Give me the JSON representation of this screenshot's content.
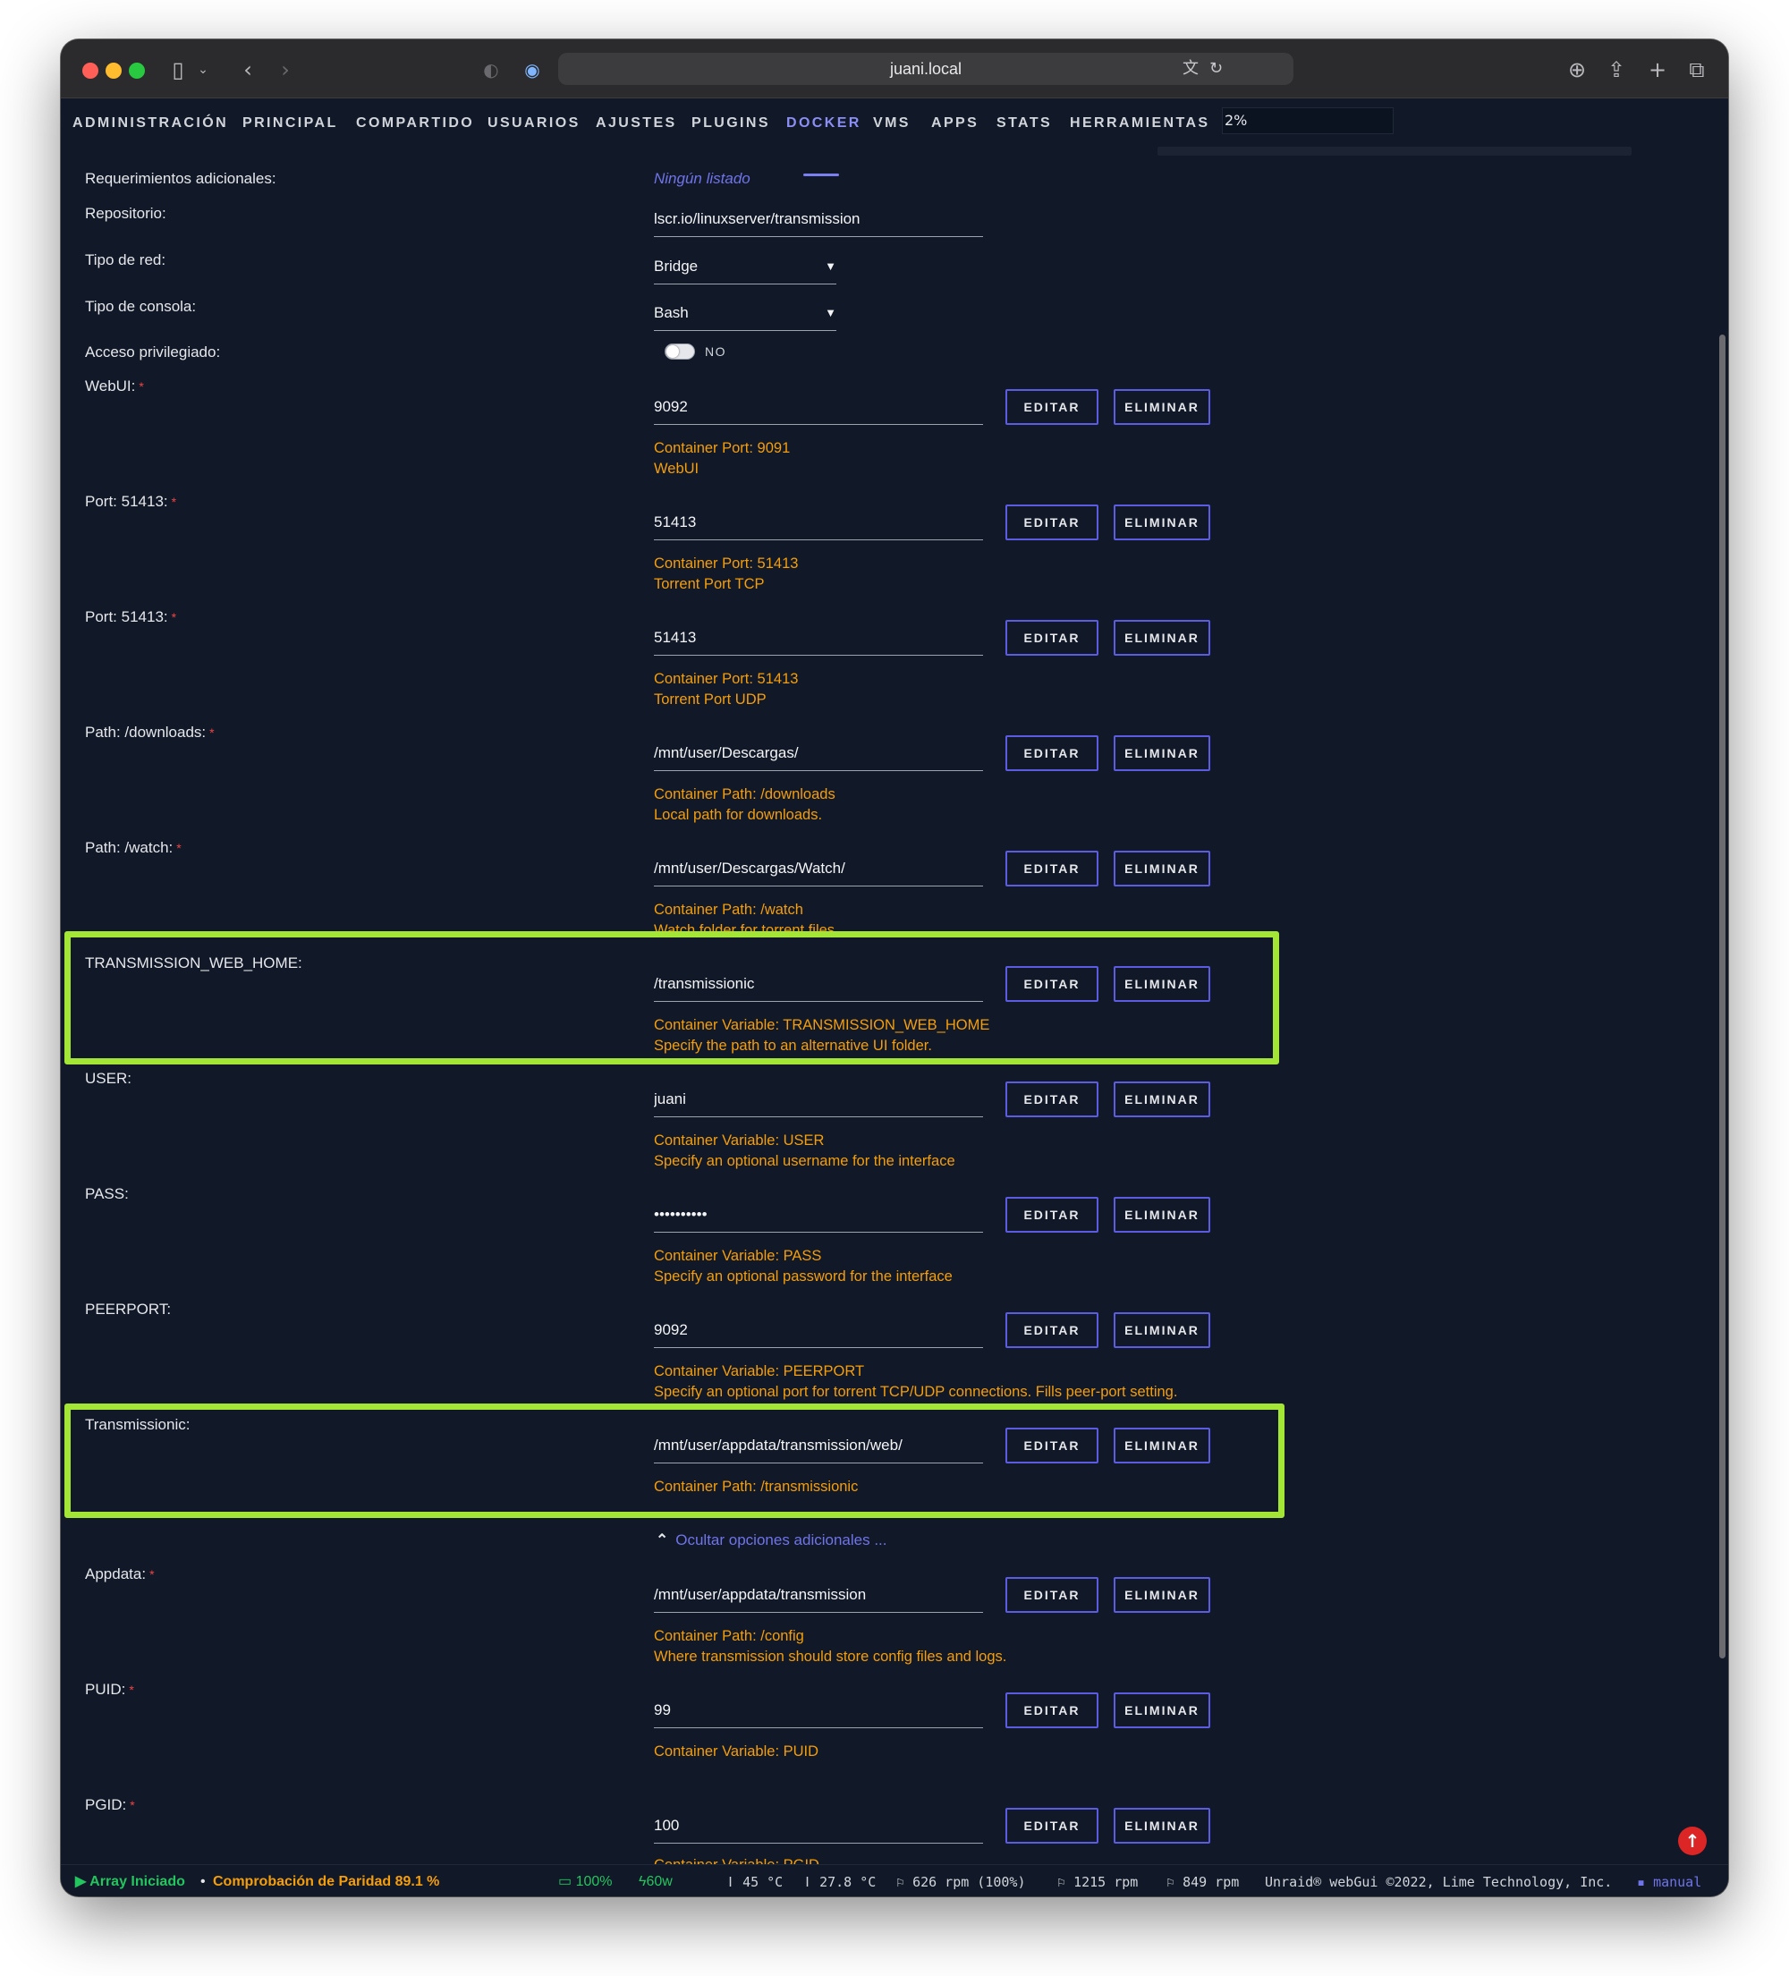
{
  "browser": {
    "url": "juani.local"
  },
  "nav": {
    "items": [
      "ADMINISTRACIÓN",
      "PRINCIPAL",
      "COMPARTIDO",
      "USUARIOS",
      "AJUSTES",
      "PLUGINS",
      "DOCKER",
      "VMS",
      "APPS",
      "STATS",
      "HERRAMIENTAS"
    ],
    "active": "DOCKER",
    "cpu_load": "2%"
  },
  "settings": {
    "extra_requirements_label": "Requerimientos adicionales:",
    "extra_requirements_value": "Ningún listado",
    "repository_label": "Repositorio:",
    "repository_value": "lscr.io/linuxserver/transmission",
    "network_label": "Tipo de red:",
    "network_value": "Bridge",
    "console_label": "Tipo de consola:",
    "console_value": "Bash",
    "privileged_label": "Acceso privilegiado:",
    "privileged_value": "NO"
  },
  "buttons": {
    "edit": "EDITAR",
    "delete": "ELIMINAR"
  },
  "fields": [
    {
      "label": "WebUI:",
      "required": true,
      "value": "9092",
      "desc1": "Container Port: 9091",
      "desc2": "WebUI"
    },
    {
      "label": "Port: 51413:",
      "required": true,
      "value": "51413",
      "desc1": "Container Port: 51413",
      "desc2": "Torrent Port TCP"
    },
    {
      "label": "Port: 51413:",
      "required": true,
      "value": "51413",
      "desc1": "Container Port: 51413",
      "desc2": "Torrent Port UDP"
    },
    {
      "label": "Path: /downloads:",
      "required": true,
      "value": "/mnt/user/Descargas/",
      "desc1": "Container Path: /downloads",
      "desc2": "Local path for downloads."
    },
    {
      "label": "Path: /watch:",
      "required": true,
      "value": "/mnt/user/Descargas/Watch/",
      "desc1": "Container Path: /watch",
      "desc2": "Watch folder for torrent files."
    },
    {
      "label": "TRANSMISSION_WEB_HOME:",
      "required": false,
      "value": "/transmissionic",
      "desc1": "Container Variable: TRANSMISSION_WEB_HOME",
      "desc2": "Specify the path to an alternative UI folder."
    },
    {
      "label": "USER:",
      "required": false,
      "value": "juani",
      "desc1": "Container Variable: USER",
      "desc2": "Specify an optional username for the interface"
    },
    {
      "label": "PASS:",
      "required": false,
      "value": "••••••••••",
      "desc1": "Container Variable: PASS",
      "desc2": "Specify an optional password for the interface"
    },
    {
      "label": "PEERPORT:",
      "required": false,
      "value": "9092",
      "desc1": "Container Variable: PEERPORT",
      "desc2": "Specify an optional port for torrent TCP/UDP connections. Fills peer-port setting."
    },
    {
      "label": "Transmissionic:",
      "required": false,
      "value": "/mnt/user/appdata/transmission/web/",
      "desc1": "Container Path: /transmissionic",
      "desc2": ""
    }
  ],
  "hide_advanced": "Ocultar opciones adicionales ...",
  "fields2": [
    {
      "label": "Appdata:",
      "required": true,
      "value": "/mnt/user/appdata/transmission",
      "desc1": "Container Path: /config",
      "desc2": "Where transmission should store config files and logs."
    },
    {
      "label": "PUID:",
      "required": true,
      "value": "99",
      "desc1": "Container Variable: PUID",
      "desc2": ""
    },
    {
      "label": "PGID:",
      "required": true,
      "value": "100",
      "desc1": "Container Variable: PGID",
      "desc2": ""
    }
  ],
  "footer": {
    "array_status": "Array Iniciado",
    "separator": "•",
    "parity": "Comprobación de Paridad 89.1 %",
    "battery": "100%",
    "power": "60w",
    "temp1": "45 °C",
    "temp2": "27.8 °C",
    "fan1": "626 rpm (100%)",
    "fan2": "1215 rpm",
    "fan3": "849 rpm",
    "copyright": "Unraid® webGui ©2022, Lime Technology, Inc.",
    "manual": "manual"
  },
  "colors": {
    "background": "#111827",
    "accent": "#5b5ce2",
    "description": "#f59e0b",
    "highlight": "#a3e635",
    "required": "#ef4444"
  }
}
